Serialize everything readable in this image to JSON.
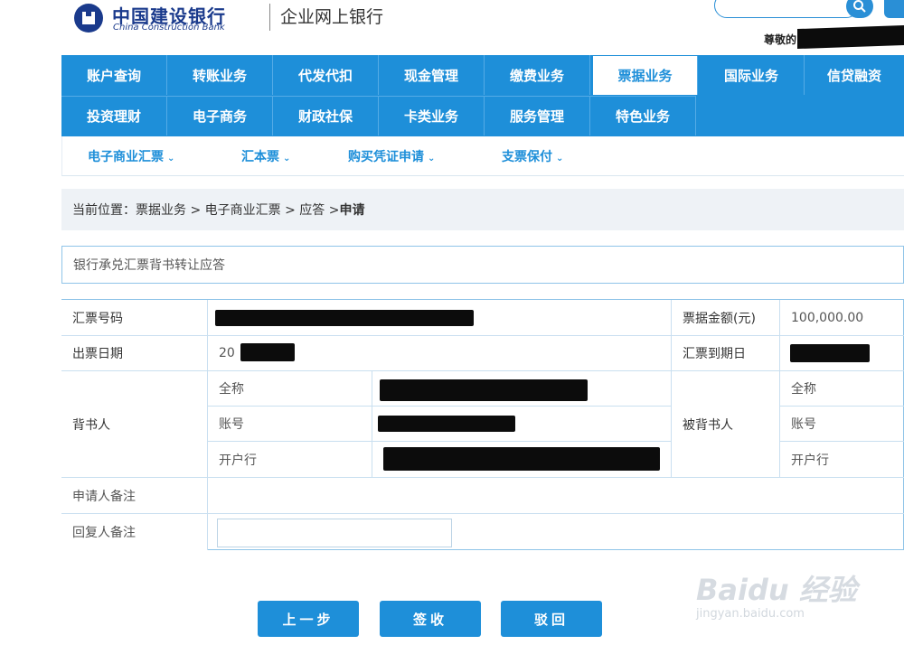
{
  "header": {
    "brand_cn": "中国建设银行",
    "brand_en": "China Construction Bank",
    "sub_title": "企业网上银行",
    "user_label": "尊敬的"
  },
  "nav": {
    "row1": [
      "账户查询",
      "转账业务",
      "代发代扣",
      "现金管理",
      "缴费业务",
      "票据业务",
      "国际业务",
      "信贷融资"
    ],
    "row2": [
      "投资理财",
      "电子商务",
      "财政社保",
      "卡类业务",
      "服务管理",
      "特色业务"
    ],
    "active": "票据业务"
  },
  "subnav": [
    "电子商业汇票",
    "汇本票",
    "购买凭证申请",
    "支票保付"
  ],
  "breadcrumb": {
    "prefix": "当前位置：票据业务 > 电子商业汇票 > 应答 > ",
    "current": "申请"
  },
  "section_title": "银行承兑汇票背书转让应答",
  "table": {
    "bill_no_label": "汇票号码",
    "amount_label": "票据金额(元)",
    "amount_value": "100,000.00",
    "issue_date_label": "出票日期",
    "issue_date_value": "20",
    "due_date_label": "汇票到期日",
    "endorser_label": "背书人",
    "endorsee_label": "被背书人",
    "full_name": "全称",
    "account_no": "账号",
    "bank": "开户行",
    "applicant_remark": "申请人备注",
    "reply_remark": "回复人备注"
  },
  "buttons": {
    "prev": "上一步",
    "sign": "签收",
    "reject": "驳回"
  },
  "watermark": {
    "text": "Baidu 经验",
    "sub": "jingyan.baidu.com"
  }
}
